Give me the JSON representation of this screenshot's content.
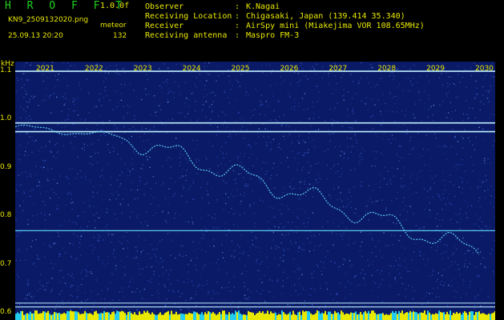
{
  "header": {
    "app_title": "H R O F F T",
    "version": "1.0.0f",
    "filename": "KN9_2509132020.png",
    "meteor_label": "meteor",
    "datetime": "25.09.13 20:20",
    "meteor_count": "132",
    "info": [
      {
        "key": "Observer",
        "value": "K.Nagai"
      },
      {
        "key": "Receiving Location",
        "value": "Chigasaki, Japan (139.414 35.340)"
      },
      {
        "key": "Receiver",
        "value": "AirSpy mini (Miakejima VOR 108.65MHz)"
      },
      {
        "key": "Receiving antenna",
        "value": "Maspro FM-3"
      }
    ]
  },
  "chart_data": {
    "type": "heatmap",
    "ylabel": "kHz",
    "y_ticks": [
      "1.1",
      "1.0",
      "0.9",
      "0.8",
      "0.7",
      "0.6"
    ],
    "x_ticks": [
      "2021",
      "2022",
      "2023",
      "2024",
      "2025",
      "2026",
      "2027",
      "2028",
      "2029",
      "2030"
    ],
    "ylim": [
      0.585,
      1.12
    ],
    "horizontal_lines_khz": [
      1.1,
      0.993,
      0.975,
      0.77,
      0.62,
      0.612
    ],
    "colors": {
      "background": "#0a1a66",
      "noise": "#3355cc",
      "signal": "#66ddff",
      "text": "#e8e800",
      "title": "#1fd21f",
      "bottom_bar": "#e8e800"
    }
  }
}
